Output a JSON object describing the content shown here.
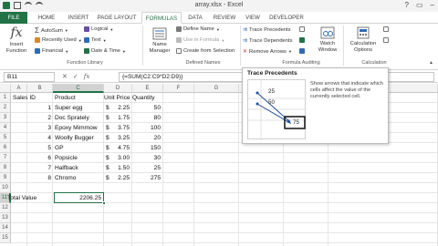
{
  "window": {
    "title": "array.xlsx - Excel",
    "help_glyph": "?",
    "restore_glyph": "▭",
    "minimize_glyph": "–"
  },
  "tabs": [
    {
      "label": "FILE"
    },
    {
      "label": "HOME"
    },
    {
      "label": "INSERT"
    },
    {
      "label": "PAGE LAYOUT"
    },
    {
      "label": "FORMULAS"
    },
    {
      "label": "DATA"
    },
    {
      "label": "REVIEW"
    },
    {
      "label": "VIEW"
    },
    {
      "label": "DEVELOPER"
    }
  ],
  "ribbon": {
    "insert_function": {
      "line1": "Insert",
      "line2": "Function"
    },
    "autosum": "AutoSum",
    "recently_used": "Recently Used",
    "financial": "Financial",
    "logical": "Logical",
    "text": "Text",
    "date_time": "Date & Time",
    "function_library_label": "Function Library",
    "name_manager": {
      "line1": "Name",
      "line2": "Manager"
    },
    "define_name": "Define Name",
    "use_in_formula": "Use in Formula",
    "create_from_selection": "Create from Selection",
    "defined_names_label": "Defined Names",
    "trace_precedents": "Trace Precedents",
    "trace_dependents": "Trace Dependents",
    "remove_arrows": "Remove Arrows",
    "formula_auditing_label": "Formula Auditing",
    "watch_window": {
      "line1": "Watch",
      "line2": "Window"
    },
    "calculation_options": {
      "line1": "Calculation",
      "line2": "Options"
    },
    "calculation_label": "Calculation",
    "colors": {
      "green": "#217346",
      "blue": "#2e6db4",
      "gray": "#7a7a7a",
      "purple": "#6a4fa3",
      "orange": "#d7892d"
    }
  },
  "formula_bar": {
    "name_box": "B11",
    "cancel_glyph": "✕",
    "enter_glyph": "✓",
    "fx_glyph": "fx",
    "formula": "{=SUM(C2:C9*D2:D9)}"
  },
  "columns": [
    "A",
    "B",
    "C",
    "D",
    "E",
    "F",
    "G",
    "H",
    "I",
    "J"
  ],
  "rows": [
    "1",
    "2",
    "3",
    "4",
    "5",
    "6",
    "7",
    "8",
    "9",
    "10",
    "11",
    "12",
    "13",
    "14",
    "15"
  ],
  "table": {
    "headers": {
      "a": "Sales ID",
      "b": "Product",
      "c": "Unit Price",
      "d": "Quantity"
    },
    "data": [
      {
        "id": "1",
        "product": "Super egg",
        "cur": "$",
        "price": "2.25",
        "qty": "50"
      },
      {
        "id": "2",
        "product": "Doc Sprately",
        "cur": "$",
        "price": "1.75",
        "qty": "80"
      },
      {
        "id": "3",
        "product": "Epoxy Mimmow",
        "cur": "$",
        "price": "3.75",
        "qty": "100"
      },
      {
        "id": "4",
        "product": "Woolly Bugger",
        "cur": "$",
        "price": "3.25",
        "qty": "20"
      },
      {
        "id": "5",
        "product": "GP",
        "cur": "$",
        "price": "4.75",
        "qty": "150"
      },
      {
        "id": "6",
        "product": "Popsicle",
        "cur": "$",
        "price": "3.00",
        "qty": "30"
      },
      {
        "id": "7",
        "product": "Halfback",
        "cur": "$",
        "price": "1.50",
        "qty": "25"
      },
      {
        "id": "8",
        "product": "Chromo",
        "cur": "$",
        "price": "2.25",
        "qty": "275"
      }
    ],
    "total_label": "Total Value",
    "total_value": "2206.25"
  },
  "tooltip": {
    "title": "Trace Precedents",
    "description": "Show arrows that indicate which cells affect the value of the currently selected cell.",
    "example_values": [
      "25",
      "50",
      "75"
    ]
  }
}
